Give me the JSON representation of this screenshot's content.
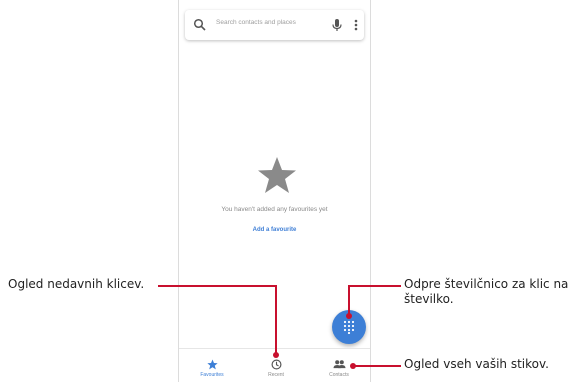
{
  "search": {
    "placeholder": "Search contacts and places"
  },
  "empty_state": {
    "message": "You haven't added any favourites yet",
    "action_label": "Add a favourite"
  },
  "bottom_nav": {
    "items": [
      {
        "label": "Favourites",
        "icon": "star-icon",
        "active": true
      },
      {
        "label": "Recent",
        "icon": "clock-icon",
        "active": false
      },
      {
        "label": "Contacts",
        "icon": "people-icon",
        "active": false
      }
    ]
  },
  "fab": {
    "icon": "dialpad-icon"
  },
  "callouts": {
    "recent": "Ogled nedavnih klicev.",
    "dialpad_line1": "Odpre številčnico za klic na",
    "dialpad_line2": "številko.",
    "contacts": "Ogled vseh vaših stikov."
  },
  "colors": {
    "accent": "#3d7fd6",
    "callout_line": "#c8102e",
    "star": "#8a8a8a"
  }
}
